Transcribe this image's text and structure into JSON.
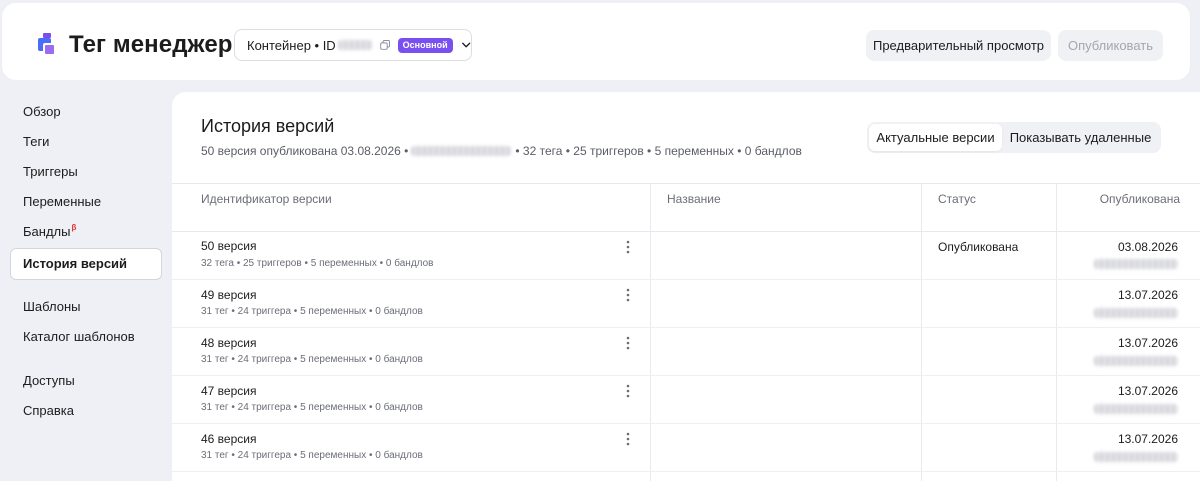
{
  "header": {
    "brand": "Тег менеджер",
    "container_label": "Контейнер • ID",
    "container_badge": "Основной",
    "preview_label": "Предварительный просмотр",
    "publish_label": "Опубликовать"
  },
  "sidebar": {
    "items": [
      {
        "label": "Обзор"
      },
      {
        "label": "Теги"
      },
      {
        "label": "Триггеры"
      },
      {
        "label": "Переменные"
      },
      {
        "label": "Бандлы",
        "sup": "β"
      },
      {
        "label": "История версий",
        "active": true
      },
      {
        "label": "Шаблоны"
      },
      {
        "label": "Каталог шаблонов"
      },
      {
        "label": "Доступы"
      },
      {
        "label": "Справка"
      }
    ]
  },
  "main": {
    "title": "История версий",
    "summary_prefix": "50 версия опубликована 03.08.2026 •",
    "summary_suffix": "• 32 тега • 25 триггеров • 5 переменных • 0 бандлов",
    "segment": {
      "active": "Актуальные версии",
      "inactive": "Показывать удаленные"
    },
    "columns": {
      "id": "Идентификатор версии",
      "name": "Название",
      "status": "Статус",
      "published": "Опубликована"
    },
    "rows": [
      {
        "name": "50 версия",
        "meta": "32 тега • 25 триггеров • 5 переменных • 0 бандлов",
        "title": "",
        "status": "Опубликована",
        "date": "03.08.2026"
      },
      {
        "name": "49 версия",
        "meta": "31 тег • 24 триггера • 5 переменных • 0 бандлов",
        "title": "",
        "status": "",
        "date": "13.07.2026"
      },
      {
        "name": "48 версия",
        "meta": "31 тег • 24 триггера • 5 переменных • 0 бандлов",
        "title": "",
        "status": "",
        "date": "13.07.2026"
      },
      {
        "name": "47 версия",
        "meta": "31 тег • 24 триггера • 5 переменных • 0 бандлов",
        "title": "",
        "status": "",
        "date": "13.07.2026"
      },
      {
        "name": "46 версия",
        "meta": "31 тег • 24 триггера • 5 переменных • 0 бандлов",
        "title": "",
        "status": "",
        "date": "13.07.2026"
      }
    ]
  },
  "colors": {
    "accent": "#7a4ff0",
    "logo_primary": "#4b6cf7",
    "logo_secondary": "#9a6cf0",
    "page_bg": "#eef0f5"
  }
}
